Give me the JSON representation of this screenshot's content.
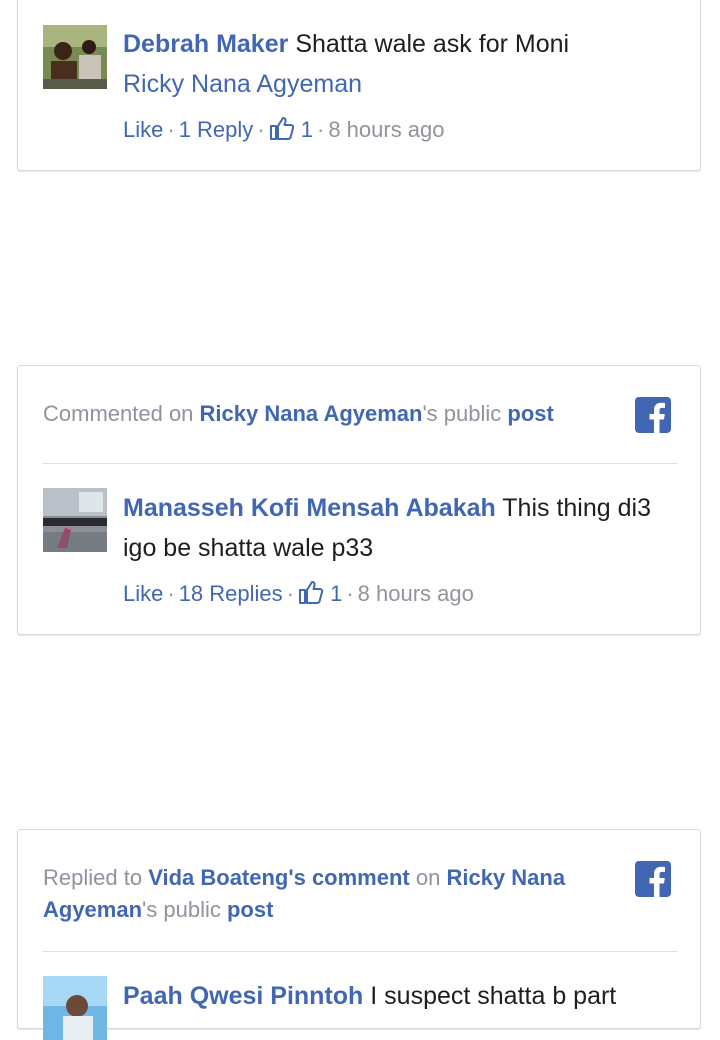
{
  "colors": {
    "link": "#4267b2",
    "muted": "#90949c",
    "text": "#1c1e21",
    "facebook": "#4267b2"
  },
  "cards": [
    {
      "author": "Debrah Maker",
      "text": "Shatta wale ask for Moni",
      "mention": "Ricky Nana Agyeman",
      "like_label": "Like",
      "replies_label": "1 Reply",
      "likes": "1",
      "time": "8 hours ago"
    },
    {
      "header": {
        "prefix": "Commented on ",
        "page_owner": "Ricky Nana Agyeman",
        "suffix": "'s public ",
        "post_link": "post"
      },
      "author": "Manasseh Kofi Mensah Abakah",
      "text": "This thing di3 igo be shatta wale p33",
      "like_label": "Like",
      "replies_label": "18 Replies",
      "likes": "1",
      "time": "8 hours ago"
    },
    {
      "header": {
        "prefix": "Replied to ",
        "comment_ref": "Vida Boateng's comment",
        "middle": " on ",
        "page_owner": "Ricky Nana Agyeman",
        "suffix": "'s public ",
        "post_link": "post"
      },
      "author": "Paah Qwesi Pinntoh",
      "text": "I suspect shatta b part"
    }
  ],
  "icons": {
    "facebook": "facebook-icon",
    "like": "thumbs-up-icon"
  }
}
